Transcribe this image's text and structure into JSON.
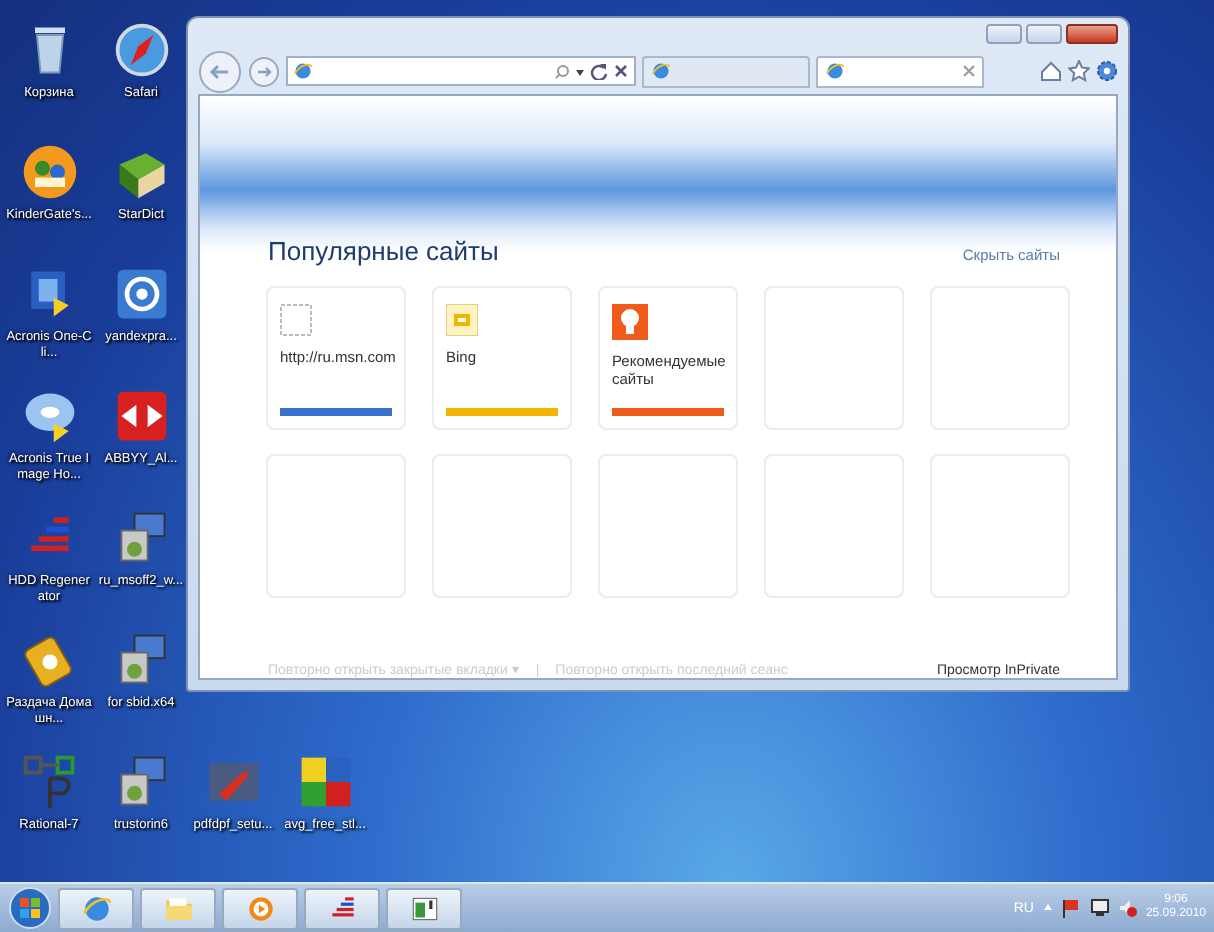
{
  "desktop_icons": [
    {
      "label": "Корзина",
      "kind": "trash"
    },
    {
      "label": "KinderGate's...",
      "kind": "people"
    },
    {
      "label": "Acronis One-Cli...",
      "kind": "monitor"
    },
    {
      "label": "Acronis True Image Ho...",
      "kind": "disc"
    },
    {
      "label": "HDD Regenerator",
      "kind": "bars"
    },
    {
      "label": "Раздача Домашн...",
      "kind": "ticket"
    },
    {
      "label": "Rational-7",
      "kind": "diagram"
    },
    {
      "label": "Safari",
      "kind": "compass"
    },
    {
      "label": "StarDict",
      "kind": "book"
    },
    {
      "label": "yandexpra...",
      "kind": "at"
    },
    {
      "label": "ABBYY_Al...",
      "kind": "arrows"
    },
    {
      "label": "ru_msoff2_w...",
      "kind": "installer"
    },
    {
      "label": "for sbid.x64",
      "kind": "installer"
    },
    {
      "label": "trustorin6",
      "kind": "installer"
    },
    {
      "label": "pdfdpf_setu...",
      "kind": "brush"
    },
    {
      "label": "avg_free_stl...",
      "kind": "squares"
    }
  ],
  "browser": {
    "tabs": [
      {
        "selected": false
      },
      {
        "selected": true
      }
    ],
    "heading": "Популярные сайты",
    "hide_link": "Скрыть сайты",
    "tiles": [
      {
        "kind": "blank",
        "label": "http://ru.msn.com",
        "color": "#3b6fd0"
      },
      {
        "kind": "bing",
        "label": "Bing",
        "color": "#f4b400"
      },
      {
        "kind": "bulb",
        "label": "Рекомендуемые сайты",
        "color": "#f05a1a"
      },
      {
        "kind": "empty"
      },
      {
        "kind": "empty"
      },
      {
        "kind": "empty"
      },
      {
        "kind": "empty"
      },
      {
        "kind": "empty"
      },
      {
        "kind": "empty"
      },
      {
        "kind": "empty"
      }
    ],
    "footer": {
      "reopen_tabs": "Повторно открыть закрытые вкладки ▾",
      "separator": "|",
      "reopen_session": "Повторно открыть последний сеанс",
      "inprivate": "Просмотр InPrivate"
    }
  },
  "taskbar": {
    "apps": [
      {
        "kind": "ie",
        "selected": false
      },
      {
        "kind": "folder",
        "selected": false
      },
      {
        "kind": "player",
        "selected": false
      },
      {
        "kind": "bars",
        "selected": false
      },
      {
        "kind": "window",
        "selected": false
      }
    ],
    "language": "RU",
    "time": "9:06",
    "date": "25.09.2010"
  }
}
